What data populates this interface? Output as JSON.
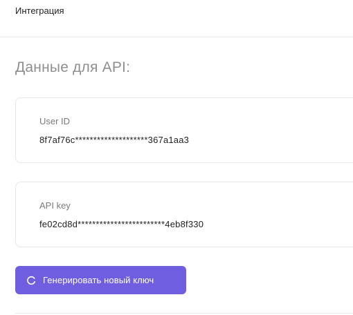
{
  "header": {
    "title": "Интеграция"
  },
  "section": {
    "title": "Данные для API:"
  },
  "user_id": {
    "label": "User ID",
    "value": "8f7af76c********************367a1aa3"
  },
  "api_key": {
    "label": "API key",
    "value": "fe02cd8d************************4eb8f330"
  },
  "actions": {
    "generate_label": "Генерировать новый ключ",
    "generate_icon": "refresh-icon",
    "accent_color": "#6f5fe0"
  }
}
